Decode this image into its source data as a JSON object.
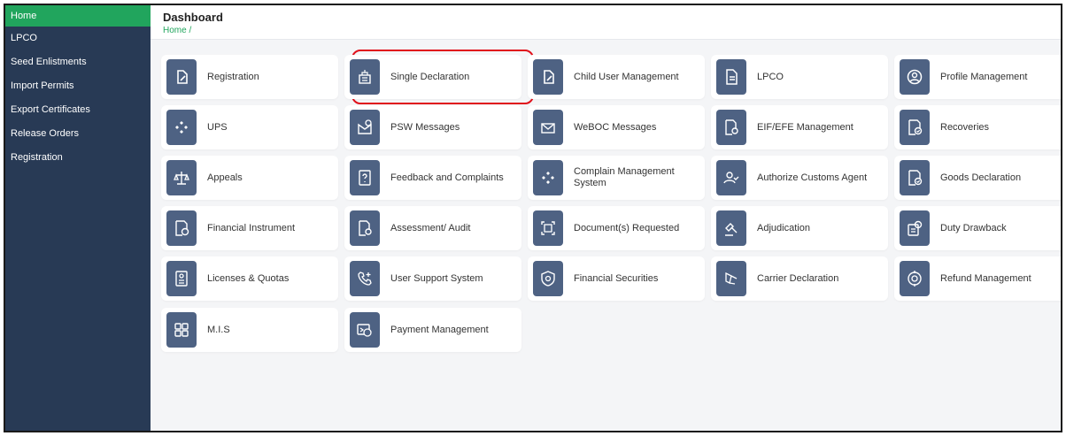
{
  "sidebar": {
    "items": [
      {
        "label": "Home"
      },
      {
        "label": "LPCO"
      },
      {
        "label": "Seed Enlistments"
      },
      {
        "label": "Import Permits"
      },
      {
        "label": "Export Certificates"
      },
      {
        "label": "Release Orders"
      },
      {
        "label": "Registration"
      }
    ]
  },
  "header": {
    "title": "Dashboard",
    "breadcrumb": "Home /"
  },
  "tiles": [
    {
      "label": "Registration",
      "icon": "edit-icon"
    },
    {
      "label": "Single Declaration",
      "icon": "building-icon"
    },
    {
      "label": "Child User Management",
      "icon": "edit-icon"
    },
    {
      "label": "LPCO",
      "icon": "document-icon"
    },
    {
      "label": "Profile Management",
      "icon": "profile-icon"
    },
    {
      "label": "UPS",
      "icon": "diamond-icon"
    },
    {
      "label": "PSW Messages",
      "icon": "message-icon"
    },
    {
      "label": "WeBOC Messages",
      "icon": "envelope-icon"
    },
    {
      "label": "EIF/EFE Management",
      "icon": "document-search-icon"
    },
    {
      "label": "Recoveries",
      "icon": "document-check-icon"
    },
    {
      "label": "Appeals",
      "icon": "scale-icon"
    },
    {
      "label": "Feedback and Complaints",
      "icon": "question-icon"
    },
    {
      "label": "Complain Management System",
      "icon": "diamond-icon"
    },
    {
      "label": "Authorize Customs Agent",
      "icon": "user-check-icon"
    },
    {
      "label": "Goods Declaration",
      "icon": "document-check-icon"
    },
    {
      "label": "Financial Instrument",
      "icon": "document-money-icon"
    },
    {
      "label": "Assessment/ Audit",
      "icon": "document-search-icon"
    },
    {
      "label": "Document(s) Requested",
      "icon": "scan-icon"
    },
    {
      "label": "Adjudication",
      "icon": "gavel-icon"
    },
    {
      "label": "Duty Drawback",
      "icon": "drawback-icon"
    },
    {
      "label": "Licenses & Quotas",
      "icon": "license-icon"
    },
    {
      "label": "User Support System",
      "icon": "phone-icon"
    },
    {
      "label": "Financial Securities",
      "icon": "shield-icon"
    },
    {
      "label": "Carrier Declaration",
      "icon": "carrier-icon"
    },
    {
      "label": "Refund Management",
      "icon": "refund-icon"
    },
    {
      "label": "M.I.S",
      "icon": "grid-icon"
    },
    {
      "label": "Payment Management",
      "icon": "payment-icon"
    }
  ],
  "colors": {
    "sidebar_bg": "#283a55",
    "active_green": "#21a55d",
    "icon_bg": "#4e6283",
    "highlight_red": "#e0111b"
  }
}
